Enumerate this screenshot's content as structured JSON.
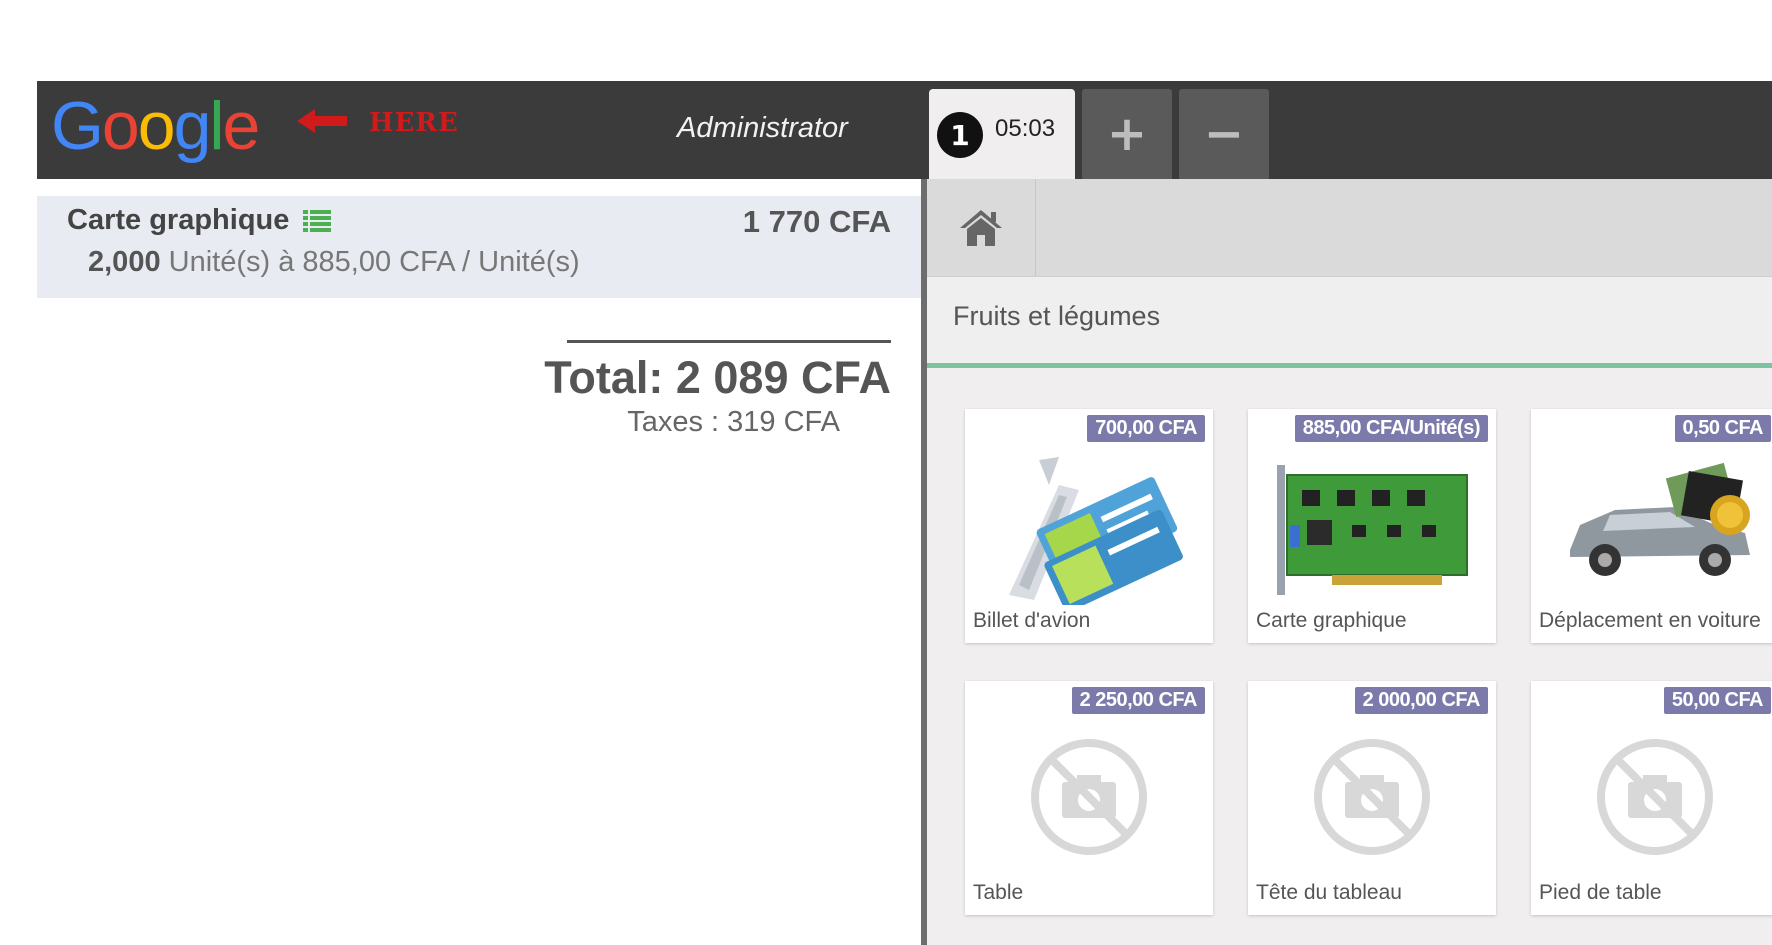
{
  "header": {
    "logo_text": "Google",
    "here_label": "HERE",
    "user_name": "Administrator",
    "order_tab": {
      "number": "1",
      "time": "05:03"
    },
    "add_order_symbol": "+",
    "remove_order_symbol": "−"
  },
  "order": {
    "line": {
      "product_name": "Carte graphique",
      "line_total": "1 770 CFA",
      "quantity": "2,000",
      "unit_detail": "Unité(s) à 885,00 CFA / Unité(s)"
    },
    "total": "Total: 2 089 CFA",
    "taxes": "Taxes : 319 CFA"
  },
  "products_panel": {
    "category": "Fruits et légumes",
    "products": [
      {
        "name": "Billet d'avion",
        "price": "700,00 CFA",
        "image": "plane-ticket-icon"
      },
      {
        "name": "Carte graphique",
        "price": "885,00 CFA/Unité(s)",
        "image": "graphics-card-icon"
      },
      {
        "name": "Déplacement en voiture",
        "price": "0,50 CFA",
        "image": "car-travel-icon"
      },
      {
        "name": "Table",
        "price": "2 250,00 CFA",
        "image": "no-photo-icon"
      },
      {
        "name": "Tête du tableau",
        "price": "2 000,00 CFA",
        "image": "no-photo-icon"
      },
      {
        "name": "Pied de table",
        "price": "50,00 CFA",
        "image": "no-photo-icon"
      }
    ]
  },
  "colors": {
    "topbar": "#3b3b3b",
    "price_tag": "#7b7aaa",
    "category_accent": "#7ec3a0",
    "here_red": "#d11a1a"
  }
}
